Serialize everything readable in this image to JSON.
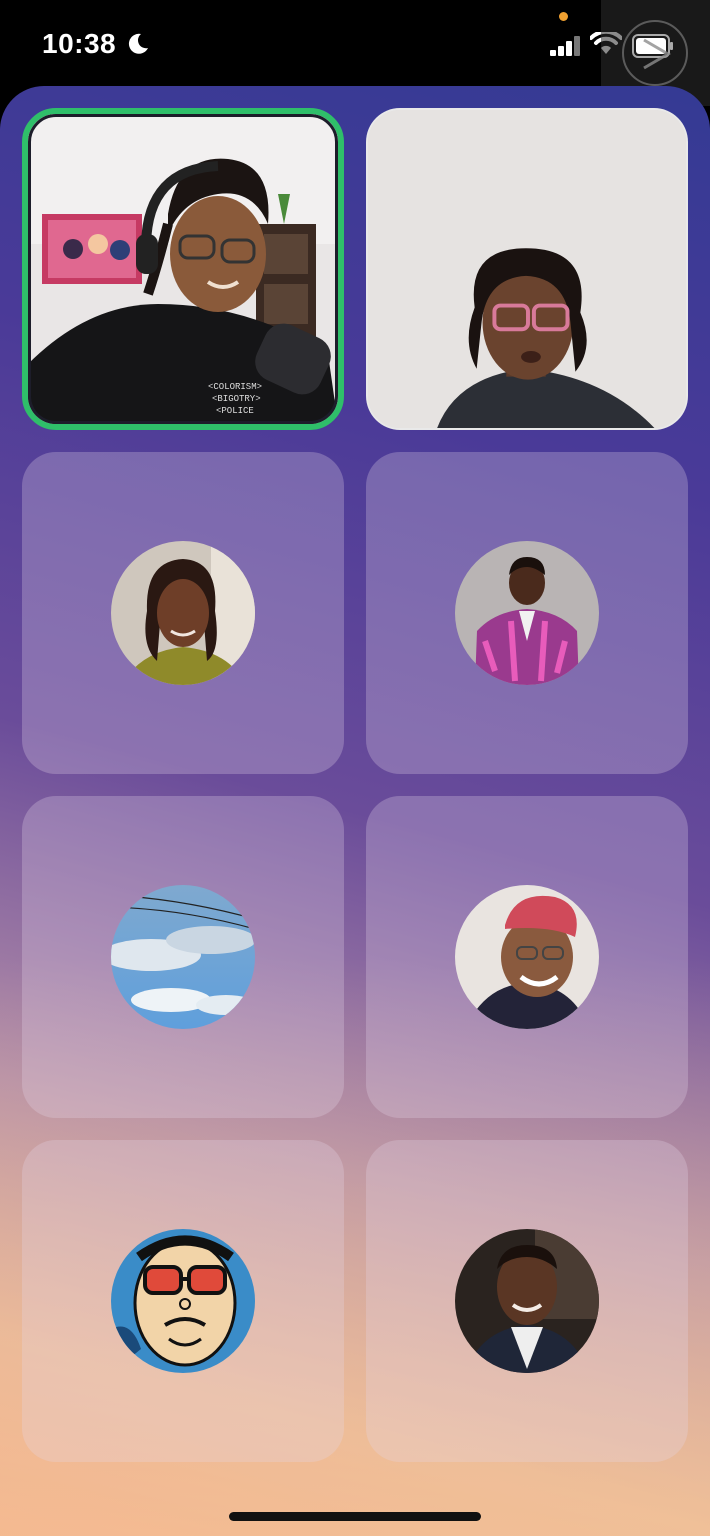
{
  "status_bar": {
    "time": "10:38",
    "focus_icon": "moon-icon",
    "privacy_indicator_color": "#f0a030",
    "signal_icon": "cellular-signal-icon",
    "wifi_icon": "wifi-icon",
    "battery_icon": "battery-icon"
  },
  "call": {
    "active_speaker_color": "#2fbf6a",
    "participants": [
      {
        "tile": "video",
        "active_speaker": true,
        "image": "man-with-headphones-and-glasses-video"
      },
      {
        "tile": "video",
        "active_speaker": false,
        "image": "woman-with-glasses-video"
      },
      {
        "tile": "avatar",
        "image": "woman-avatar"
      },
      {
        "tile": "avatar",
        "image": "man-in-patterned-shirt-avatar"
      },
      {
        "tile": "avatar",
        "image": "sky-photo-avatar"
      },
      {
        "tile": "avatar",
        "image": "man-with-red-cap-avatar"
      },
      {
        "tile": "avatar",
        "image": "cartoon-sunglasses-avatar"
      },
      {
        "tile": "avatar",
        "image": "man-in-suit-avatar"
      }
    ]
  }
}
